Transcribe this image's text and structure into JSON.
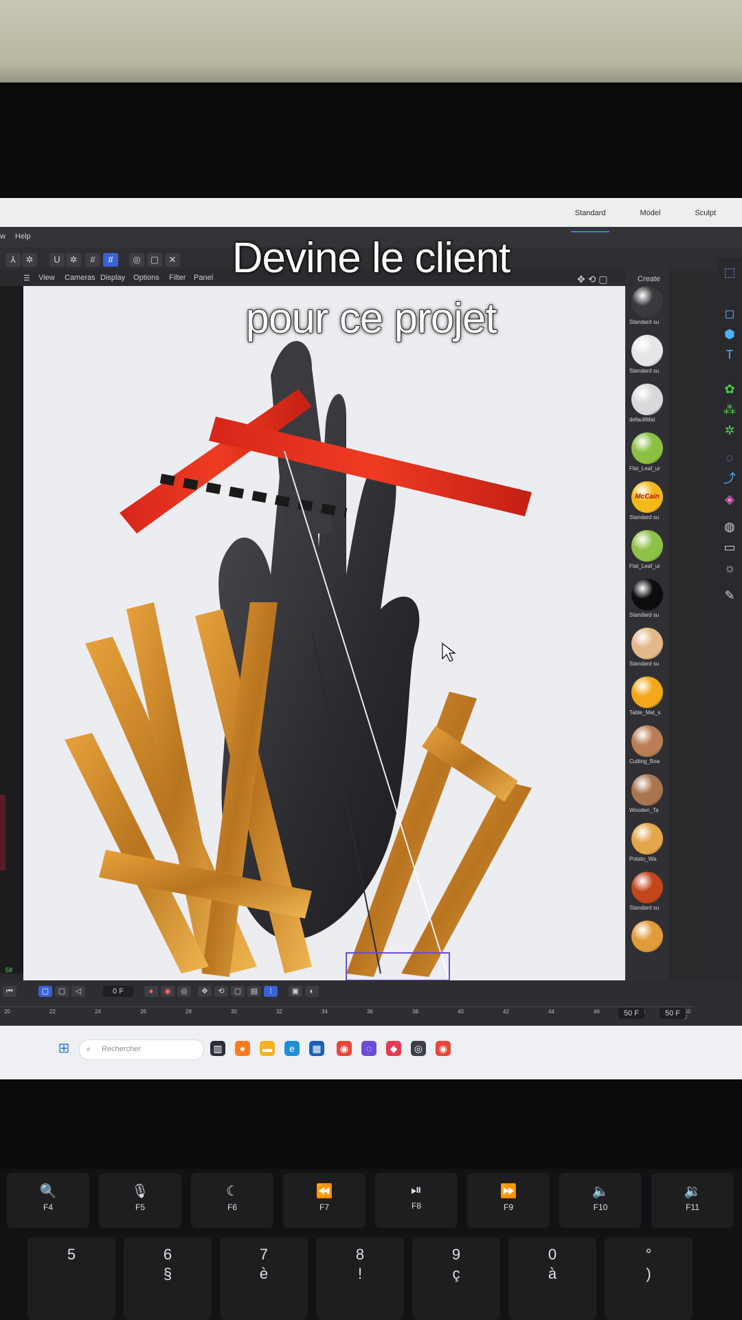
{
  "caption": {
    "line1": "Devine le client",
    "line2": "pour ce projet"
  },
  "app": {
    "layout_tabs": [
      "Standard",
      "Model",
      "Sculpt"
    ],
    "menubar": [
      "w",
      "Help"
    ],
    "viewport_menu": [
      "View",
      "Cameras",
      "Display",
      "Options",
      "Filter",
      "Panel"
    ],
    "material_header": "Create"
  },
  "materials": [
    {
      "label": "Standard su",
      "color": "#3a3a3e"
    },
    {
      "label": "Standard su",
      "color": "#e6e6e8"
    },
    {
      "label": "defaultMat",
      "color": "#d9d9dc"
    },
    {
      "label": "Flat_Leaf_ur",
      "color": "#8cc043"
    },
    {
      "label": "Standard su",
      "color": "#f3b81a",
      "logo": "McCain"
    },
    {
      "label": "Flat_Leaf_ur",
      "color": "#8fc047"
    },
    {
      "label": "Standard su",
      "color": "#0d0d0f"
    },
    {
      "label": "Standard su",
      "color": "#e3b88a"
    },
    {
      "label": "Table_Mat_s",
      "color": "#f2a81a"
    },
    {
      "label": "Cutting_Boa",
      "color": "#b97e55"
    },
    {
      "label": "Wooden_Ta",
      "color": "#a8754e"
    },
    {
      "label": "Potato_Wa",
      "color": "#e3a64a"
    },
    {
      "label": "Standard su",
      "color": "#c2451c"
    },
    {
      "label": "",
      "color": "#e09b3a"
    }
  ],
  "timeline": {
    "frame_field": "0 F",
    "ticks": [
      "20",
      "22",
      "24",
      "26",
      "28",
      "30",
      "32",
      "34",
      "36",
      "38",
      "40",
      "42",
      "44",
      "46",
      "48",
      "50 F"
    ],
    "end_field_1": "50 F",
    "end_field_2": "50 F",
    "left_readout": "58"
  },
  "taskbar": {
    "search_placeholder": "Rechercher"
  },
  "keyboard": {
    "fn_keys": [
      {
        "sym": "🔍",
        "label": "F4"
      },
      {
        "sym": "🎙",
        "label": "F5"
      },
      {
        "sym": "☾",
        "label": "F6"
      },
      {
        "sym": "⏪",
        "label": "F7"
      },
      {
        "sym": "⏯",
        "label": "F8"
      },
      {
        "sym": "⏩",
        "label": "F9"
      },
      {
        "sym": "🔈",
        "label": "F10"
      },
      {
        "sym": "🔉",
        "label": "F11"
      }
    ],
    "num_keys": [
      {
        "top": "",
        "bot": "5"
      },
      {
        "top": "6",
        "bot": "§"
      },
      {
        "top": "7",
        "bot": "è"
      },
      {
        "top": "8",
        "bot": "!"
      },
      {
        "top": "9",
        "bot": "ç"
      },
      {
        "top": "0",
        "bot": "à"
      },
      {
        "top": "°",
        "bot": ")"
      }
    ]
  },
  "colors": {
    "accent": "#3a62d6",
    "caption_text": "#ffffff"
  }
}
